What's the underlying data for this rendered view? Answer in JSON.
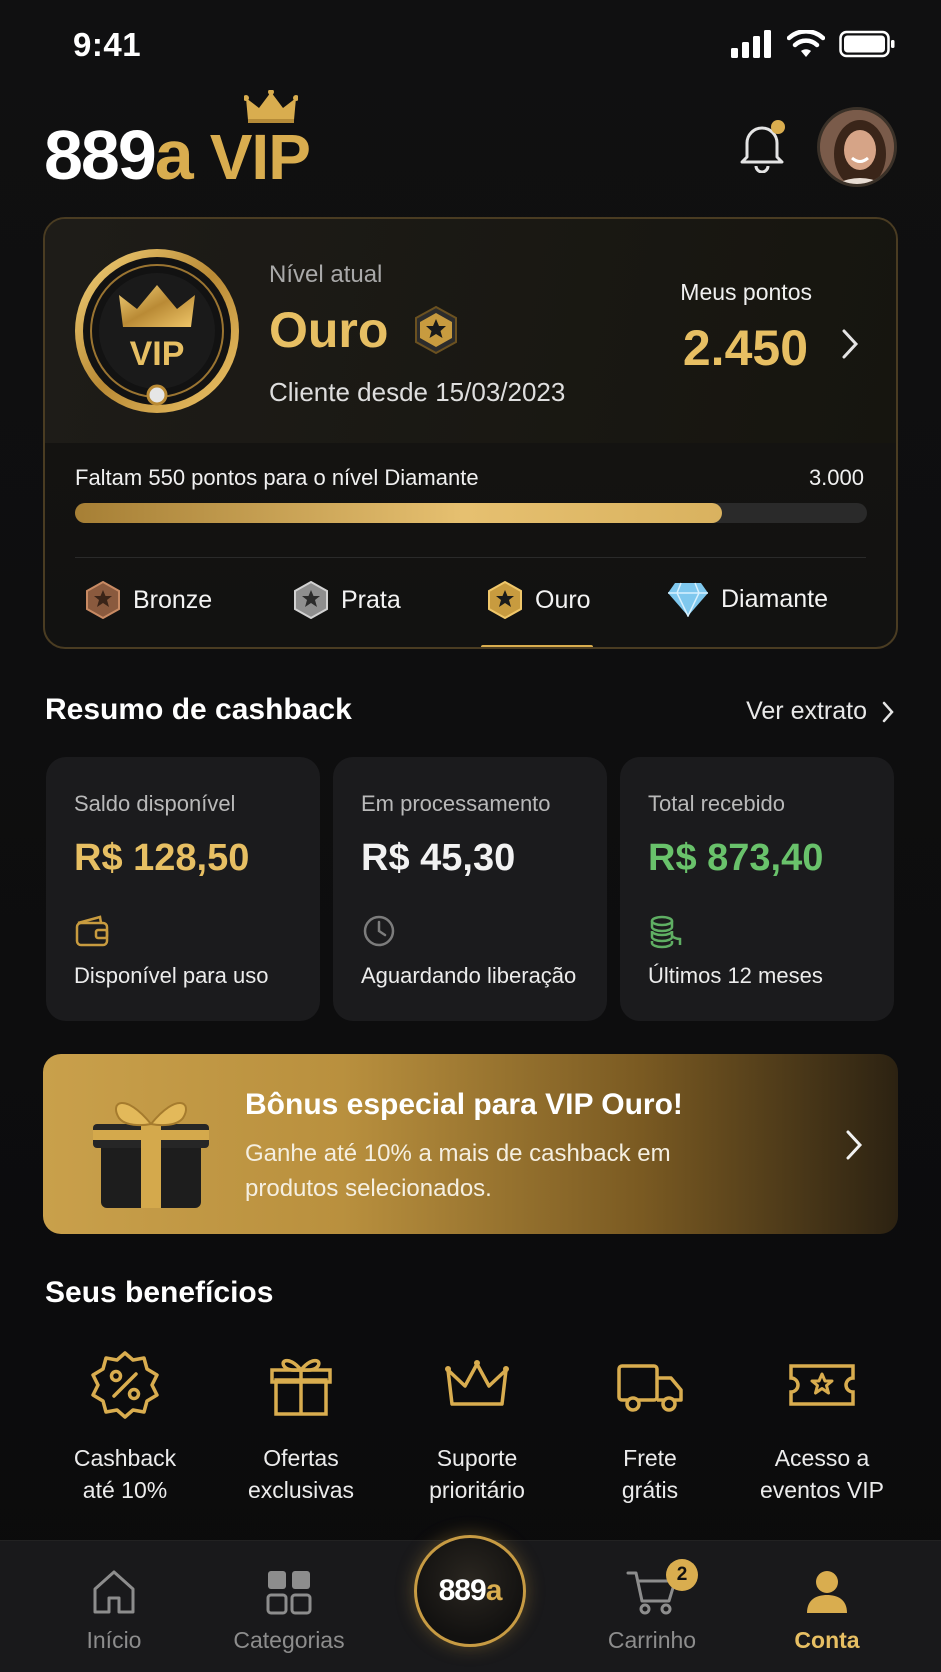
{
  "status_bar": {
    "time": "9:41"
  },
  "header": {
    "logo_number": "889",
    "logo_letter": "a",
    "logo_vip": "VIP"
  },
  "vip_card": {
    "level_label": "Nível atual",
    "level_name": "Ouro",
    "client_since": "Cliente desde 15/03/2023",
    "points_label": "Meus pontos",
    "points_value": "2.450",
    "progress_text": "Faltam 550 pontos para o nível Diamante",
    "progress_max": "3.000",
    "progress_fraction": 0.8167,
    "tiers": [
      {
        "label": "Bronze",
        "icon": "bronze-star-icon"
      },
      {
        "label": "Prata",
        "icon": "silver-star-icon"
      },
      {
        "label": "Ouro",
        "icon": "gold-star-icon",
        "active": true
      },
      {
        "label": "Diamante",
        "icon": "diamond-icon"
      }
    ]
  },
  "cashback": {
    "title": "Resumo de cashback",
    "link": "Ver extrato",
    "cards": [
      {
        "label": "Saldo disponível",
        "value": "R$ 128,50",
        "sub": "Disponível para uso",
        "color": "#e7bf63",
        "icon": "wallet-icon"
      },
      {
        "label": "Em processamento",
        "value": "R$ 45,30",
        "sub": "Aguardando liberação",
        "color": "#f2f2f2",
        "icon": "clock-icon"
      },
      {
        "label": "Total recebido",
        "value": "R$ 873,40",
        "sub": "Últimos 12 meses",
        "color": "#69c26b",
        "icon": "coins-icon"
      }
    ]
  },
  "banner": {
    "title": "Bônus especial para VIP Ouro!",
    "text": "Ganhe até 10% a mais de cashback em produtos selecionados."
  },
  "benefits": {
    "title": "Seus benefícios",
    "items": [
      {
        "line1": "Cashback",
        "line2": "até 10%",
        "icon": "percent-badge-icon"
      },
      {
        "line1": "Ofertas",
        "line2": "exclusivas",
        "icon": "gift-icon"
      },
      {
        "line1": "Suporte",
        "line2": "prioritário",
        "icon": "crown-icon"
      },
      {
        "line1": "Frete",
        "line2": "grátis",
        "icon": "truck-icon"
      },
      {
        "line1": "Acesso a",
        "line2": "eventos VIP",
        "icon": "ticket-star-icon"
      }
    ]
  },
  "nav": {
    "home": "Início",
    "categories": "Categorias",
    "center_number": "889",
    "center_letter": "a",
    "cart": "Carrinho",
    "cart_count": "2",
    "account": "Conta"
  },
  "colors": {
    "gold": "#d9ad4f",
    "green": "#69c26b",
    "background": "#0d0d0e"
  }
}
